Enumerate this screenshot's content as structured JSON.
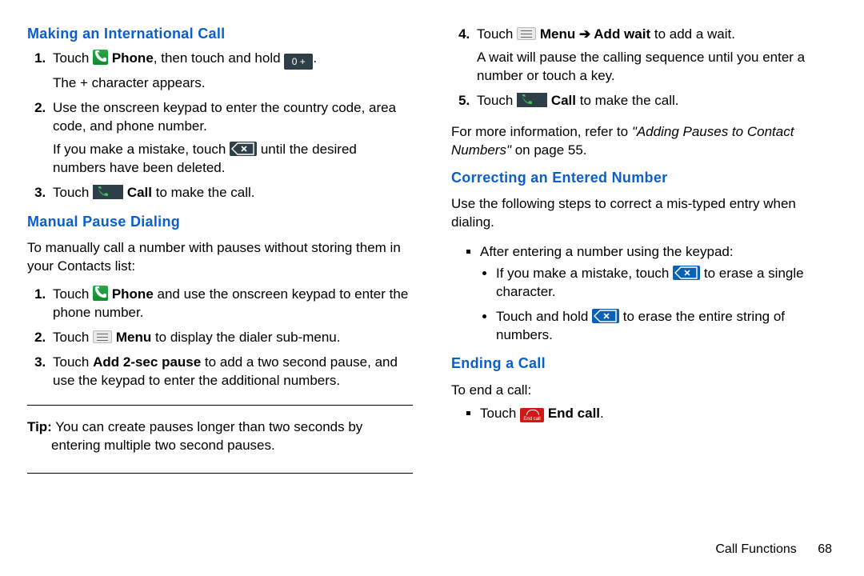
{
  "left": {
    "h_intl": "Making an International Call",
    "intl": {
      "s1_a": "Touch ",
      "s1_phone": "Phone",
      "s1_b": ", then touch and hold ",
      "s1_c": ".",
      "s1_d": "The + character appears.",
      "s2_a": "Use the onscreen keypad to enter the country code, area code, and phone number.",
      "s2_b": "If you make a mistake, touch ",
      "s2_c": " until the desired numbers have been deleted.",
      "s3_a": "Touch ",
      "s3_call": "Call",
      "s3_b": " to make the call."
    },
    "h_pause": "Manual Pause Dialing",
    "pause_intro": "To manually call a number with pauses without storing them in your Contacts list:",
    "pause": {
      "s1_a": "Touch ",
      "s1_phone": "Phone",
      "s1_b": " and use the onscreen keypad to enter the phone number.",
      "s2_a": "Touch ",
      "s2_menu": "Menu",
      "s2_b": " to display the dialer sub-menu.",
      "s3_a": "Touch ",
      "s3_add2": "Add 2-sec pause",
      "s3_b": " to add a two second pause, and use the keypad to enter the additional numbers."
    },
    "tip_label": "Tip:",
    "tip_text": " You can create pauses longer than two seconds by entering multiple two second pauses."
  },
  "right": {
    "cont": {
      "s4_a": "Touch ",
      "s4_menu": "Menu",
      "s4_arrow": " ➔ ",
      "s4_addwait": "Add wait",
      "s4_b": " to add a wait.",
      "s4_c": "A wait will pause the calling sequence until you enter a number or touch a key.",
      "s5_a": "Touch ",
      "s5_call": "Call",
      "s5_b": " to make the call."
    },
    "moreinfo_a": "For more information, refer to ",
    "moreinfo_ref": "\"Adding Pauses to Contact Numbers\"",
    "moreinfo_b": " on page 55.",
    "h_correct": "Correcting an Entered Number",
    "correct_intro": "Use the following steps to correct a mis-typed entry when dialing.",
    "correct_sq1": "After entering a number using the keypad:",
    "correct_b1_a": "If you make a mistake, touch ",
    "correct_b1_b": " to erase a single character.",
    "correct_b2_a": "Touch and hold ",
    "correct_b2_b": " to erase the entire string of numbers.",
    "h_end": "Ending a Call",
    "end_intro": "To end a call:",
    "end_sq_a": "Touch ",
    "end_sq_label": "End call",
    "end_sq_b": "."
  },
  "footer": {
    "section": "Call Functions",
    "page": "68"
  },
  "icons": {
    "zero_text": "0  +",
    "endcall_text": "End call"
  }
}
